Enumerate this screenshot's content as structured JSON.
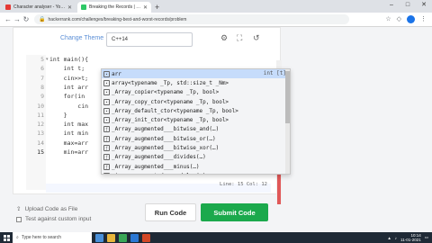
{
  "browser": {
    "tabs": [
      {
        "label": "Character analyser - YouTube Studio",
        "active": false,
        "color": "#e53935"
      },
      {
        "label": "Breaking the Records | HackerRank",
        "active": true,
        "color": "#2ec866"
      }
    ],
    "new_tab": "+",
    "url": "hackerrank.com/challenges/breaking-best-and-worst-records/problem",
    "window_controls": [
      "–",
      "□",
      "✕"
    ]
  },
  "editor": {
    "change_theme": "Change Theme",
    "language": "C++14",
    "line_numbers": [
      "5",
      "6",
      "7",
      "8",
      "9",
      "10",
      "11",
      "12",
      "13",
      "14",
      "15"
    ],
    "current_line": "15",
    "code_lines": [
      "int main(){",
      "    int t;",
      "    cin>>t;",
      "    int arr",
      "    for(in",
      "        cin",
      "    }",
      "    int max",
      "    int min",
      "    max=arr",
      "    min=arr"
    ],
    "status": "Line: 15 Col: 12"
  },
  "autocomplete": {
    "items": [
      {
        "text": "arr",
        "detail": "int [t]",
        "kind": "var"
      },
      {
        "text": "array<typename _Tp, std::size_t _Nm>",
        "detail": "",
        "kind": "class"
      },
      {
        "text": "_Array_copier<typename _Tp, bool>",
        "detail": "",
        "kind": "class"
      },
      {
        "text": "_Array_copy_ctor<typename _Tp, bool>",
        "detail": "",
        "kind": "class"
      },
      {
        "text": "_Array_default_ctor<typename _Tp, bool>",
        "detail": "",
        "kind": "class"
      },
      {
        "text": "_Array_init_ctor<typename _Tp, bool>",
        "detail": "",
        "kind": "class"
      },
      {
        "text": "_Array_augmented___bitwise_and(…)",
        "detail": "",
        "kind": "fn"
      },
      {
        "text": "_Array_augmented___bitwise_or(…)",
        "detail": "",
        "kind": "fn"
      },
      {
        "text": "_Array_augmented___bitwise_xor(…)",
        "detail": "",
        "kind": "fn"
      },
      {
        "text": "_Array_augmented___divides(…)",
        "detail": "",
        "kind": "fn"
      },
      {
        "text": "_Array_augmented___minus(…)",
        "detail": "",
        "kind": "fn"
      },
      {
        "text": "_Array_augmented___modulus(…)",
        "detail": "",
        "kind": "fn"
      }
    ]
  },
  "actions": {
    "upload": "Upload Code as File",
    "custom_input": "Test against custom input",
    "run": "Run Code",
    "submit": "Submit Code"
  },
  "taskbar": {
    "search_placeholder": "Type here to search",
    "time": "10:14",
    "date": "11-01-2021"
  },
  "colors": {
    "submit_green": "#1ba94c",
    "theme_link": "#5b8fd6",
    "selection": "#c6dcfb"
  }
}
